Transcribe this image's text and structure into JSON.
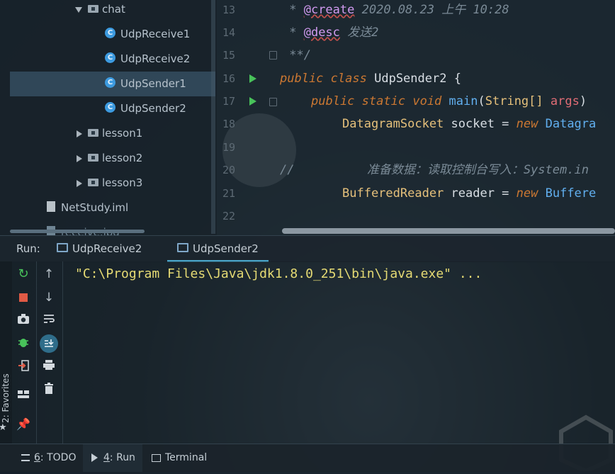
{
  "project_tree": {
    "items": [
      {
        "label": "chat",
        "kind": "folder",
        "expanded": true
      },
      {
        "label": "UdpReceive1",
        "kind": "class"
      },
      {
        "label": "UdpReceive2",
        "kind": "class"
      },
      {
        "label": "UdpSender1",
        "kind": "class",
        "selected": true
      },
      {
        "label": "UdpSender2",
        "kind": "class"
      },
      {
        "label": "lesson1",
        "kind": "folder",
        "expanded": false
      },
      {
        "label": "lesson2",
        "kind": "folder",
        "expanded": false
      },
      {
        "label": "lesson3",
        "kind": "folder",
        "expanded": false
      },
      {
        "label": "NetStudy.iml",
        "kind": "file"
      },
      {
        "label": "receive.jpg",
        "kind": "file"
      }
    ]
  },
  "editor": {
    "line_numbers": [
      "13",
      "14",
      "15",
      "16",
      "17",
      "18",
      "19",
      "20",
      "21",
      "22"
    ],
    "lines": {
      "l13": {
        "prefix": " * ",
        "ann": "@create",
        "rest": " 2020.08.23 上午 10:28"
      },
      "l14": {
        "prefix": " * ",
        "ann": "@desc",
        "rest": " 发送2"
      },
      "l15": {
        "text": " **/"
      },
      "l16": {
        "kw1": "public",
        "kw2": "class",
        "name": "UdpSender2",
        "rest": " {"
      },
      "l17": {
        "kw1": "public",
        "kw2": "static",
        "kw3": "void",
        "meth": "main",
        "paren": "(",
        "type": "String[]",
        "param": "args",
        ") ": ")"
      },
      "l18": {
        "type": "DatagramSocket",
        "var": " socket = ",
        "kw": "new",
        "rest": " Datagra"
      },
      "l20": {
        "text": "//          准备数据：读取控制台写入：System.in"
      },
      "l21": {
        "type": "BufferedReader",
        "var": " reader = ",
        "kw": "new",
        "rest": " Buffere"
      }
    }
  },
  "run_bar": {
    "label": "Run:",
    "tabs": [
      {
        "label": "UdpReceive2",
        "active": false
      },
      {
        "label": "UdpSender2",
        "active": true
      }
    ]
  },
  "console": {
    "output": "\"C:\\Program Files\\Java\\jdk1.8.0_251\\bin\\java.exe\" ..."
  },
  "side": {
    "favorites_label": "2: Favorites"
  },
  "bottom_bar": {
    "tabs": [
      {
        "key": "6",
        "label": ": TODO"
      },
      {
        "key": "4",
        "label": ": Run",
        "active": true
      },
      {
        "label": "Terminal"
      }
    ]
  },
  "colors": {
    "accent": "#4aa4c8",
    "run_green": "#48c25a",
    "stop_red": "#e05a45",
    "console_text": "#e6db74"
  }
}
